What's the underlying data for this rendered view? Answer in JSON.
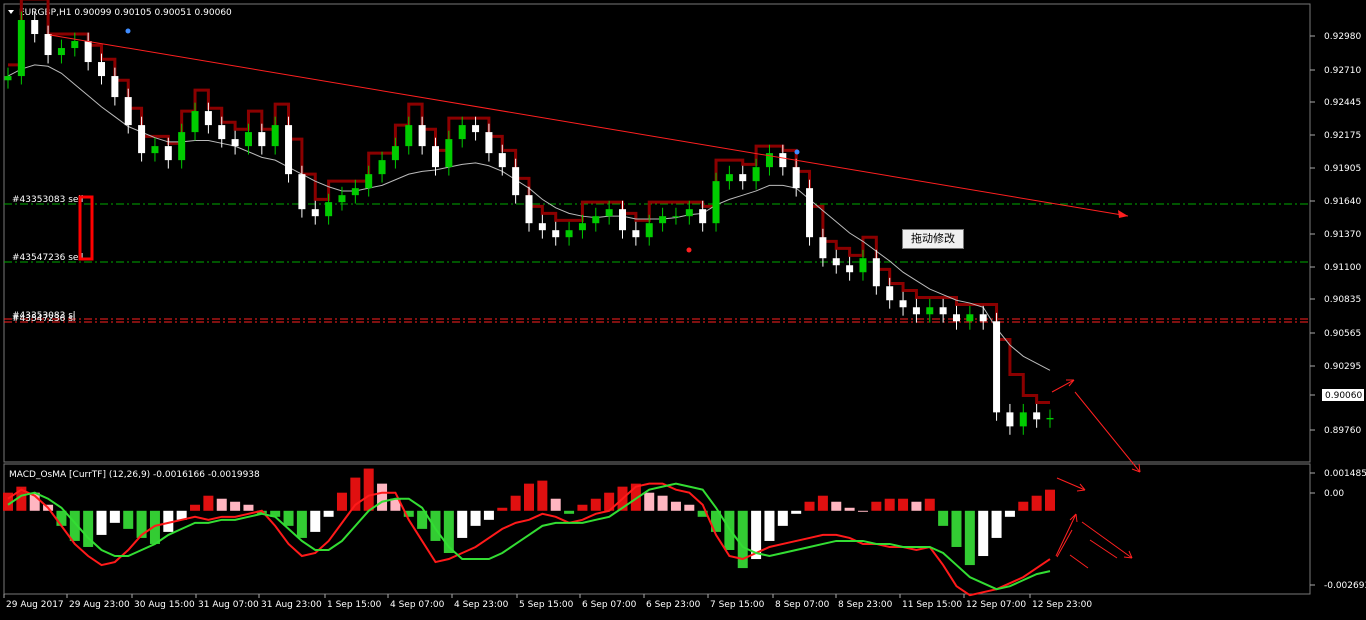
{
  "main_window": {
    "header": "EURGBP,H1  0.90099 0.90105 0.90051 0.90060",
    "price_axis": [
      "0.92980",
      "0.92710",
      "0.92445",
      "0.92175",
      "0.91905",
      "0.91640",
      "0.91370",
      "0.91100",
      "0.90835",
      "0.90565",
      "0.90295",
      "0.90060",
      "0.89760"
    ],
    "current_price": "0.90060",
    "order_labels": [
      "#43353083 sell",
      "#43547236 sell",
      "#43353083 sl",
      "#43547236 sl"
    ],
    "drag_tooltip": "拖动修改"
  },
  "indicator_window": {
    "header": "MACD_OsMA [CurrTF] (12,26,9) -0.0016166 -0.0019938",
    "axis": [
      "0.001485",
      "0.00",
      "-0.002693"
    ]
  },
  "time_axis": [
    "29 Aug 2017",
    "29 Aug 23:00",
    "30 Aug 15:00",
    "31 Aug 07:00",
    "31 Aug 23:00",
    "1 Sep 15:00",
    "4 Sep 07:00",
    "4 Sep 23:00",
    "5 Sep 15:00",
    "6 Sep 07:00",
    "6 Sep 23:00",
    "7 Sep 15:00",
    "8 Sep 07:00",
    "8 Sep 23:00",
    "11 Sep 15:00",
    "12 Sep 07:00",
    "12 Sep 23:00"
  ],
  "colors": {
    "background": "#000000",
    "bull": "#00cc00",
    "bear": "#ffffff",
    "trendline": "#ff2020",
    "trailing_stop": "#8b0000",
    "support_line": "#1e3a8a",
    "order_line": "#00aa00",
    "sl_line": "#ff2020",
    "hist_up": "#e01010",
    "hist_down": "#33cc33"
  },
  "chart_data": [
    {
      "type": "candlestick",
      "title": "EURGBP,H1",
      "ylim": [
        0.8976,
        0.93
      ],
      "close": [
        0.925,
        0.929,
        0.928,
        0.9265,
        0.927,
        0.9275,
        0.926,
        0.925,
        0.9235,
        0.9215,
        0.9195,
        0.92,
        0.919,
        0.921,
        0.9225,
        0.9215,
        0.9205,
        0.92,
        0.921,
        0.92,
        0.9215,
        0.918,
        0.9155,
        0.915,
        0.916,
        0.9165,
        0.917,
        0.918,
        0.919,
        0.92,
        0.9215,
        0.92,
        0.9185,
        0.9205,
        0.9215,
        0.921,
        0.9195,
        0.9185,
        0.9165,
        0.9145,
        0.914,
        0.9135,
        0.914,
        0.9145,
        0.915,
        0.9155,
        0.914,
        0.9135,
        0.9145,
        0.915,
        0.915,
        0.9155,
        0.9145,
        0.9175,
        0.918,
        0.9175,
        0.9185,
        0.9195,
        0.9185,
        0.917,
        0.9135,
        0.912,
        0.9115,
        0.911,
        0.912,
        0.91,
        0.909,
        0.9085,
        0.908,
        0.9085,
        0.908,
        0.9075,
        0.908,
        0.9075,
        0.901,
        0.9,
        0.901,
        0.9005,
        0.9006
      ],
      "series": [
        {
          "name": "",
          "values": [
            0.925,
            0.9255,
            0.9258,
            0.9257,
            0.9252,
            0.9244,
            0.9236,
            0.9228,
            0.9221,
            0.9214,
            0.921,
            0.9206,
            0.9203,
            0.9203,
            0.9204,
            0.9204,
            0.9202,
            0.92,
            0.9196,
            0.9192,
            0.919,
            0.9185,
            0.918,
            0.9175,
            0.9171,
            0.9168,
            0.9168,
            0.917,
            0.9172,
            0.9176,
            0.918,
            0.9182,
            0.9183,
            0.9185,
            0.9187,
            0.9188,
            0.9186,
            0.9182,
            0.9176,
            0.917,
            0.9162,
            0.9156,
            0.9152,
            0.915,
            0.9149,
            0.915,
            0.915,
            0.9148,
            0.9148,
            0.9148,
            0.9149,
            0.9151,
            0.9152,
            0.9158,
            0.9162,
            0.9165,
            0.9168,
            0.9172,
            0.9172,
            0.917,
            0.9162,
            0.9154,
            0.9146,
            0.9138,
            0.9132,
            0.9125,
            0.9118,
            0.911,
            0.9104,
            0.9098,
            0.9094,
            0.909,
            0.9088,
            0.9085,
            0.907,
            0.9058,
            0.905,
            0.9045,
            0.904
          ]
        }
      ]
    },
    {
      "type": "bar",
      "title": "MACD_OsMA [CurrTF] (12,26,9)",
      "ylim": [
        -0.002693,
        0.001485
      ],
      "values": [
        0.0006,
        0.0008,
        0.0006,
        0.0002,
        -0.0005,
        -0.001,
        -0.0012,
        -0.0008,
        -0.0004,
        -0.0006,
        -0.0009,
        -0.0011,
        -0.0007,
        -0.0003,
        0.0002,
        0.0005,
        0.0004,
        0.0003,
        0.0002,
        -0.0001,
        -0.0002,
        -0.0005,
        -0.0009,
        -0.0007,
        -0.0002,
        0.0006,
        0.0011,
        0.0014,
        0.0009,
        0.0004,
        -0.0002,
        -0.0006,
        -0.001,
        -0.0014,
        -0.0009,
        -0.0005,
        -0.0003,
        0.0001,
        0.0005,
        0.0009,
        0.001,
        0.0004,
        -0.0001,
        0.0002,
        0.0004,
        0.0006,
        0.0008,
        0.0009,
        0.0006,
        0.0005,
        0.0003,
        0.0002,
        -0.0002,
        -0.0007,
        -0.0013,
        -0.0019,
        -0.0016,
        -0.001,
        -0.0005,
        -0.0001,
        0.0003,
        0.0005,
        0.0003,
        0.0001,
        0.0,
        0.0003,
        0.0004,
        0.0004,
        0.0003,
        0.0004,
        -0.0005,
        -0.0012,
        -0.0018,
        -0.0015,
        -0.0009,
        -0.0002,
        0.0003,
        0.0005,
        0.0007
      ],
      "series": [
        {
          "name": "",
          "values": [
            0.0004,
            0.0007,
            0.0005,
            0.0001,
            -0.0005,
            -0.0011,
            -0.0015,
            -0.0018,
            -0.0017,
            -0.0013,
            -0.0008,
            -0.0005,
            -0.0004,
            -0.0003,
            -0.0002,
            -0.0003,
            -0.0002,
            -0.0002,
            -0.0001,
            0.0,
            -0.0005,
            -0.0011,
            -0.0015,
            -0.0014,
            -0.001,
            -0.0004,
            0.0002,
            0.0005,
            0.0006,
            0.0006,
            -0.0003,
            -0.001,
            -0.0017,
            -0.0016,
            -0.0014,
            -0.0012,
            -0.0009,
            -0.0006,
            -0.0004,
            -0.0003,
            -0.0001,
            -0.0002,
            -0.0004,
            -0.0003,
            -0.0001,
            0.0,
            0.0004,
            0.0008,
            0.0009,
            0.0009,
            0.0007,
            0.0006,
            0.0002,
            -0.0008,
            -0.0015,
            -0.0016,
            -0.0014,
            -0.0012,
            -0.0011,
            -0.001,
            -0.0009,
            -0.0008,
            -0.0008,
            -0.0009,
            -0.0011,
            -0.0011,
            -0.0012,
            -0.0012,
            -0.0013,
            -0.0012,
            -0.0018,
            -0.0025,
            -0.0028,
            -0.0027,
            -0.0026,
            -0.0024,
            -0.0022,
            -0.0019,
            -0.0016
          ]
        },
        {
          "name": "",
          "values": [
            0.0002,
            0.0005,
            0.0006,
            0.0004,
            0.0001,
            -0.0004,
            -0.0009,
            -0.0013,
            -0.0015,
            -0.0015,
            -0.0013,
            -0.0011,
            -0.0008,
            -0.0006,
            -0.0004,
            -0.0004,
            -0.0003,
            -0.0003,
            -0.0002,
            -0.0001,
            -0.0002,
            -0.0006,
            -0.001,
            -0.0013,
            -0.0013,
            -0.001,
            -0.0005,
            0.0,
            0.0003,
            0.0004,
            0.0004,
            0.0001,
            -0.0006,
            -0.0012,
            -0.0016,
            -0.0016,
            -0.0016,
            -0.0014,
            -0.0011,
            -0.0008,
            -0.0005,
            -0.0004,
            -0.0004,
            -0.0004,
            -0.0003,
            -0.0002,
            0.0001,
            0.0004,
            0.0007,
            0.0008,
            0.0009,
            0.0008,
            0.0007,
            0.0001,
            -0.0006,
            -0.0012,
            -0.0014,
            -0.0015,
            -0.0014,
            -0.0013,
            -0.0012,
            -0.0011,
            -0.001,
            -0.001,
            -0.001,
            -0.0011,
            -0.0011,
            -0.0012,
            -0.0012,
            -0.0012,
            -0.0014,
            -0.0018,
            -0.0022,
            -0.0024,
            -0.0026,
            -0.0025,
            -0.0023,
            -0.0021,
            -0.002
          ]
        }
      ]
    }
  ]
}
